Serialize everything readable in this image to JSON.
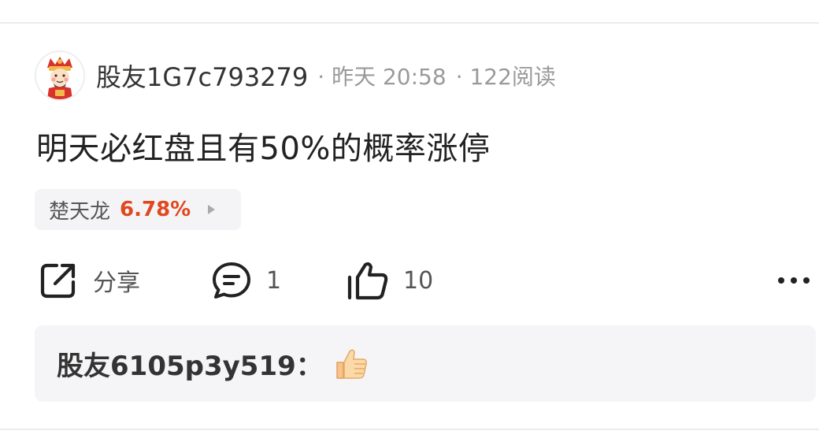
{
  "post": {
    "author": "股友1G7c793279",
    "time": "· 昨天 20:58",
    "reads": "· 122阅读",
    "content": "明天必红盘且有50%的概率涨停"
  },
  "stock_tag": {
    "name": "楚天龙",
    "change": "6.78%",
    "change_color": "#e0481e"
  },
  "actions": {
    "share_label": "分享",
    "comment_count": "1",
    "like_count": "10",
    "icons": [
      "share-icon",
      "comment-icon",
      "thumbs-up-icon",
      "more-icon"
    ]
  },
  "comment_preview": {
    "user": "股友6105p3y519",
    "colon": "：",
    "emoji": "thumbs-up-emoji"
  }
}
